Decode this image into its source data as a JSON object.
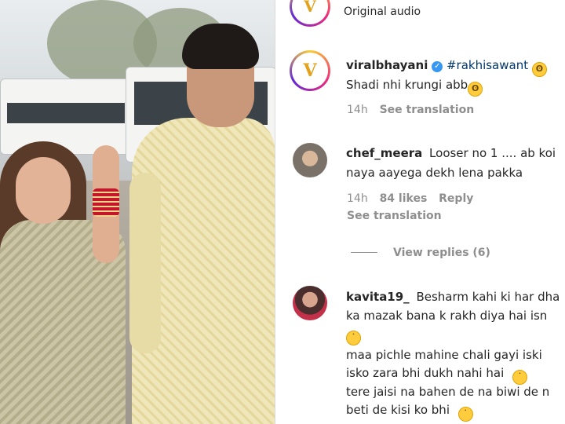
{
  "audio": {
    "label": "Original audio"
  },
  "post": {
    "username": "viralbhayani",
    "hashtag": "#rakhisawant",
    "caption": "Shadi nhi krungi abb",
    "time": "14h",
    "see_translation": "See translation",
    "avatar_letter": "V"
  },
  "comments": [
    {
      "username": "chef_meera",
      "lines": [
        "Looser no 1 .... ab koi",
        "naya aayega dekh lena pakka"
      ],
      "time": "14h",
      "likes": "84 likes",
      "reply": "Reply",
      "see_translation": "See translation",
      "view_replies": "View replies (6)"
    },
    {
      "username": "kavita19_",
      "lines": [
        "Besharm kahi ki har dha",
        "ka mazak bana k rakh diya hai isn",
        "",
        "maa pichle mahine chali gayi iski",
        "isko zara bhi dukh nahi hai",
        "tere jaisi na bahen de na biwi de n",
        "beti de kisi ko bhi"
      ]
    }
  ],
  "icons": {
    "verified": "verified-badge-icon",
    "emoji_flushed": "flushed-face-icon",
    "emoji_confused": "confused-face-icon"
  }
}
